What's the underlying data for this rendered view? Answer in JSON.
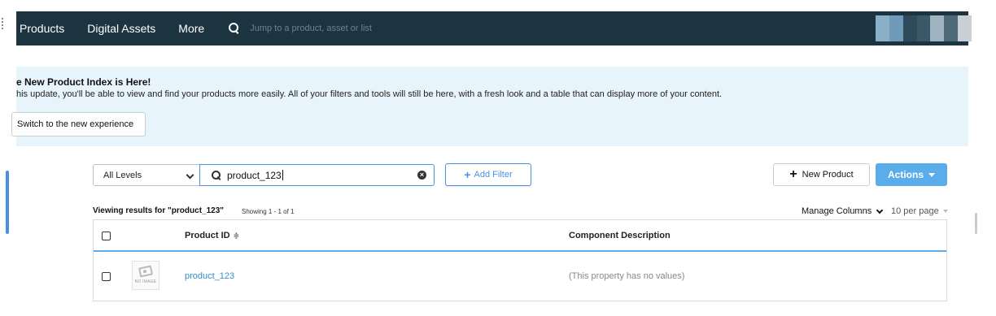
{
  "nav": {
    "items": [
      "Products",
      "Digital Assets",
      "More"
    ],
    "search_placeholder": "Jump to a product, asset or list"
  },
  "banner": {
    "title": "e New Product Index is Here!",
    "text": "his update, you'll be able to view and find your products more easily. All of your filters and tools will still be here, with a fresh look and a table that can display more of your content.",
    "button_label": "Switch to the new experience"
  },
  "toolbar": {
    "level_value": "All Levels",
    "search_value": "product_123",
    "clear_glyph": "×",
    "add_filter_label": "Add Filter",
    "new_product_label": "New Product",
    "actions_label": "Actions"
  },
  "results": {
    "viewing_text": "Viewing results for \"product_123\"",
    "showing_text": "Showing 1 - 1 of 1",
    "manage_columns_label": "Manage Columns",
    "per_page_label": "10 per page"
  },
  "table": {
    "columns": {
      "product_id": "Product ID",
      "component_description": "Component Description"
    },
    "sort_glyph": "≑",
    "rows": [
      {
        "thumb_label": "NO IMAGE",
        "product_id": "product_123",
        "component_description": "(This property has no values)"
      }
    ]
  },
  "colors": {
    "nav_bg": "#1c3340",
    "banner_bg": "#e8f4fb",
    "accent": "#4a90e2",
    "actions_bg": "#5aacea",
    "link": "#2f8fc7"
  }
}
